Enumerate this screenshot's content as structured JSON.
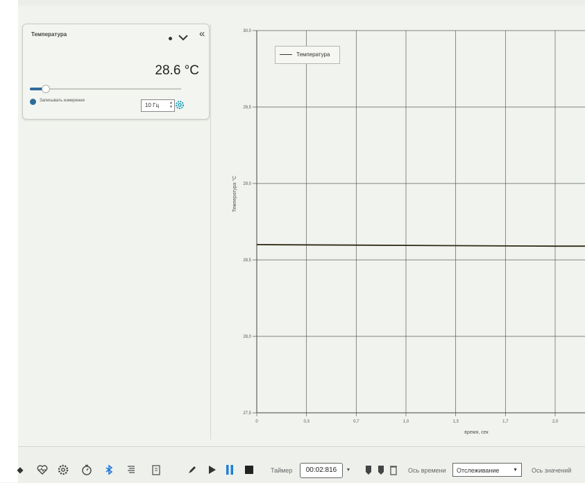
{
  "sensor": {
    "title": "Температура",
    "value": "28.6 °C",
    "slider_level": 0.1,
    "record_label": "Записывать измерения",
    "frequency": "10 Гц",
    "icons": [
      "dot-menu-icon",
      "chevron-down-icon",
      "gear-icon"
    ]
  },
  "sidebar": {
    "collapse_glyph": "«"
  },
  "chart_data": {
    "type": "line",
    "xlabel": "время, сек",
    "ylabel": "Температура °C",
    "xlim": [
      0,
      2.0
    ],
    "ylim": [
      27.5,
      30.0
    ],
    "x_ticks": [
      "0",
      "0,3",
      "0,7",
      "1,0",
      "1,3",
      "1,7",
      "2,0"
    ],
    "y_ticks": [
      "27,5",
      "28,0",
      "28,5",
      "29,0",
      "29,5",
      "30,0"
    ],
    "grid": true,
    "legend": "top-left",
    "series": [
      {
        "name": "Температура",
        "x": [
          0,
          2.0
        ],
        "y": [
          28.6,
          28.59
        ],
        "color": "#2f2a14"
      }
    ]
  },
  "toolbar": {
    "icons": [
      "heart-icon",
      "settings-icon",
      "stopwatch-icon",
      "bluetooth-icon",
      "list-icon",
      "clipboard-icon",
      "pen-icon",
      "play-icon",
      "pause-icon",
      "stop-icon"
    ],
    "timer_label": "Таймер",
    "timer_value": "00:02:816",
    "time_axis_label": "Ось времени",
    "time_axis_mode": "Отслеживание",
    "value_axis_label": "Ось значений",
    "colors": {
      "accent": "#1e7fd6",
      "bluetooth": "#1a73d8"
    }
  }
}
